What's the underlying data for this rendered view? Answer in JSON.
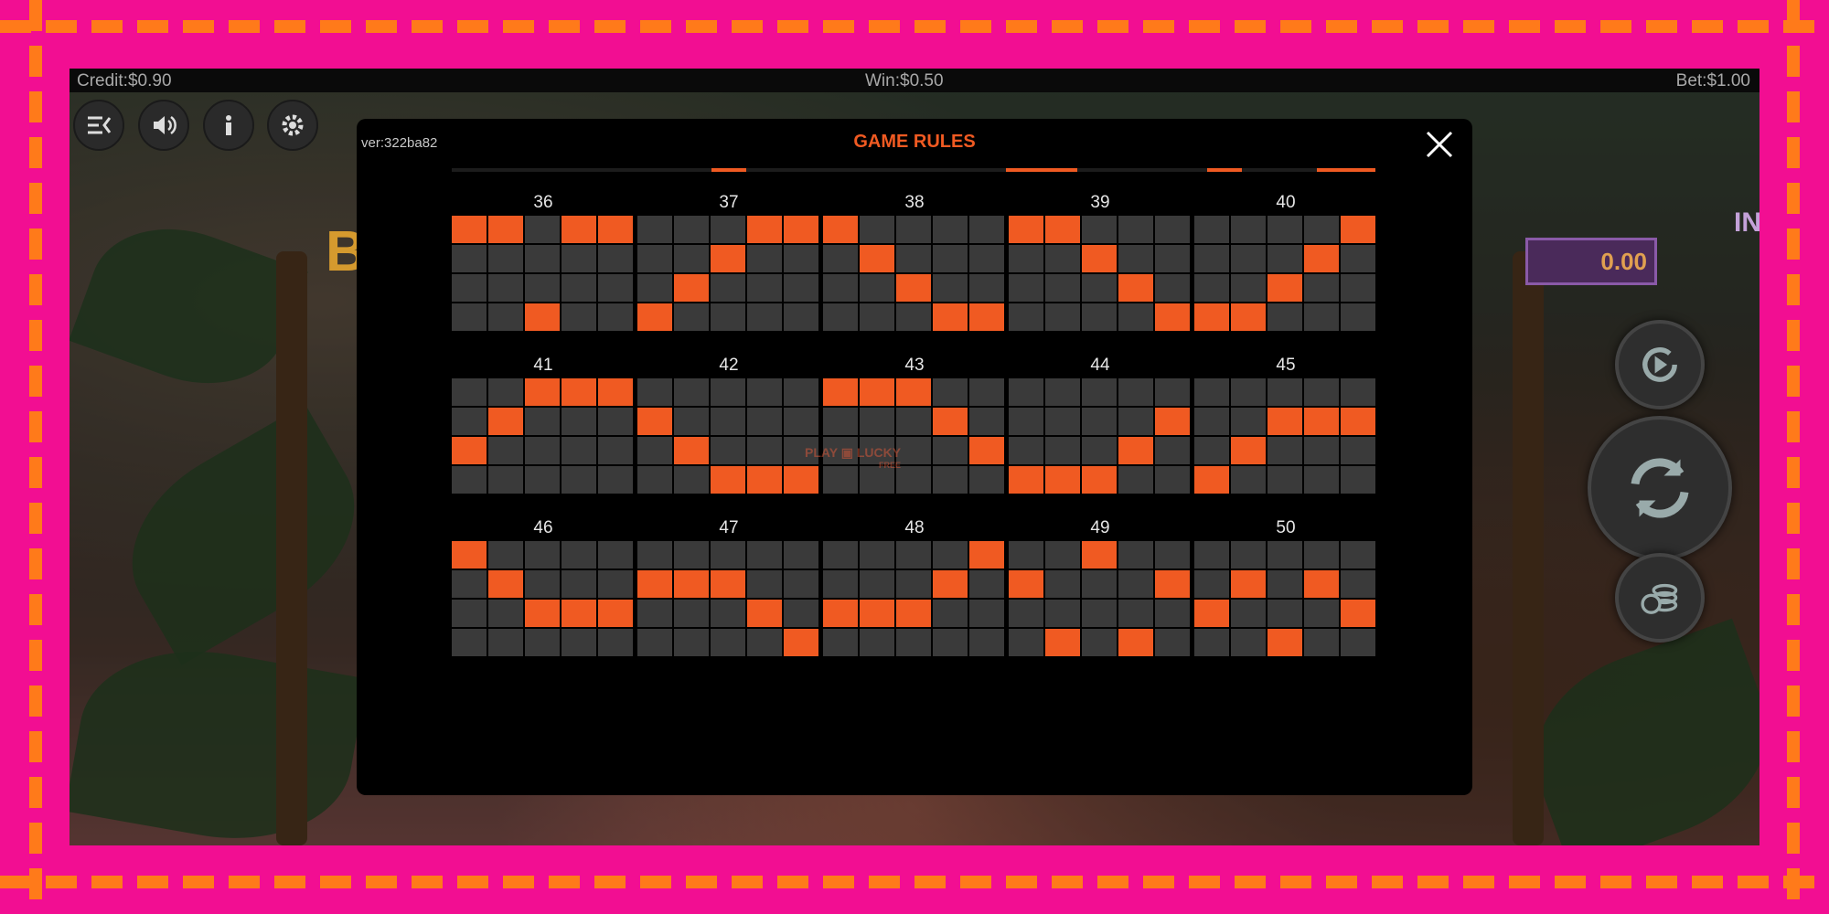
{
  "status": {
    "credit": "Credit:$0.90",
    "win": "Win:$0.50",
    "bet": "Bet:$1.00"
  },
  "controls": {
    "left": [
      "menu-icon",
      "sound-icon",
      "info-icon",
      "settings-icon"
    ],
    "right": [
      "autoplay-icon",
      "spin-icon",
      "bet-coins-icon"
    ],
    "close_glyph": "×"
  },
  "background": {
    "jackpot_label": "INI",
    "jackpot_amount": "0.00",
    "logo_fragment": "Bi"
  },
  "modal": {
    "version": "ver:322ba82",
    "title": "GAME RULES",
    "watermark": [
      "PLAY",
      "LUCKY",
      "FREE"
    ]
  },
  "colors": {
    "frame": "#f20e92",
    "dash": "#ff7a1a",
    "active_cell": "#f05a22",
    "inactive_cell": "#3a3a3a",
    "title": "#f05a22"
  },
  "paylines": [
    {
      "number": "36",
      "rows": [
        0,
        0,
        3,
        0,
        0
      ]
    },
    {
      "number": "37",
      "rows": [
        3,
        2,
        1,
        0,
        0
      ]
    },
    {
      "number": "38",
      "rows": [
        0,
        1,
        2,
        3,
        3
      ]
    },
    {
      "number": "39",
      "rows": [
        0,
        0,
        1,
        2,
        3
      ]
    },
    {
      "number": "40",
      "rows": [
        3,
        3,
        2,
        1,
        0
      ]
    },
    {
      "number": "41",
      "rows": [
        2,
        1,
        0,
        0,
        0
      ]
    },
    {
      "number": "42",
      "rows": [
        1,
        2,
        3,
        3,
        3
      ]
    },
    {
      "number": "43",
      "rows": [
        0,
        0,
        0,
        1,
        2
      ]
    },
    {
      "number": "44",
      "rows": [
        3,
        3,
        3,
        2,
        1
      ]
    },
    {
      "number": "45",
      "rows": [
        3,
        2,
        1,
        1,
        1
      ]
    },
    {
      "number": "46",
      "rows": [
        0,
        1,
        2,
        2,
        2
      ]
    },
    {
      "number": "47",
      "rows": [
        1,
        1,
        1,
        2,
        3
      ]
    },
    {
      "number": "48",
      "rows": [
        2,
        2,
        2,
        1,
        0
      ]
    },
    {
      "number": "49",
      "rows": [
        1,
        3,
        0,
        3,
        1
      ]
    },
    {
      "number": "50",
      "rows": [
        2,
        1,
        3,
        1,
        2
      ]
    }
  ]
}
